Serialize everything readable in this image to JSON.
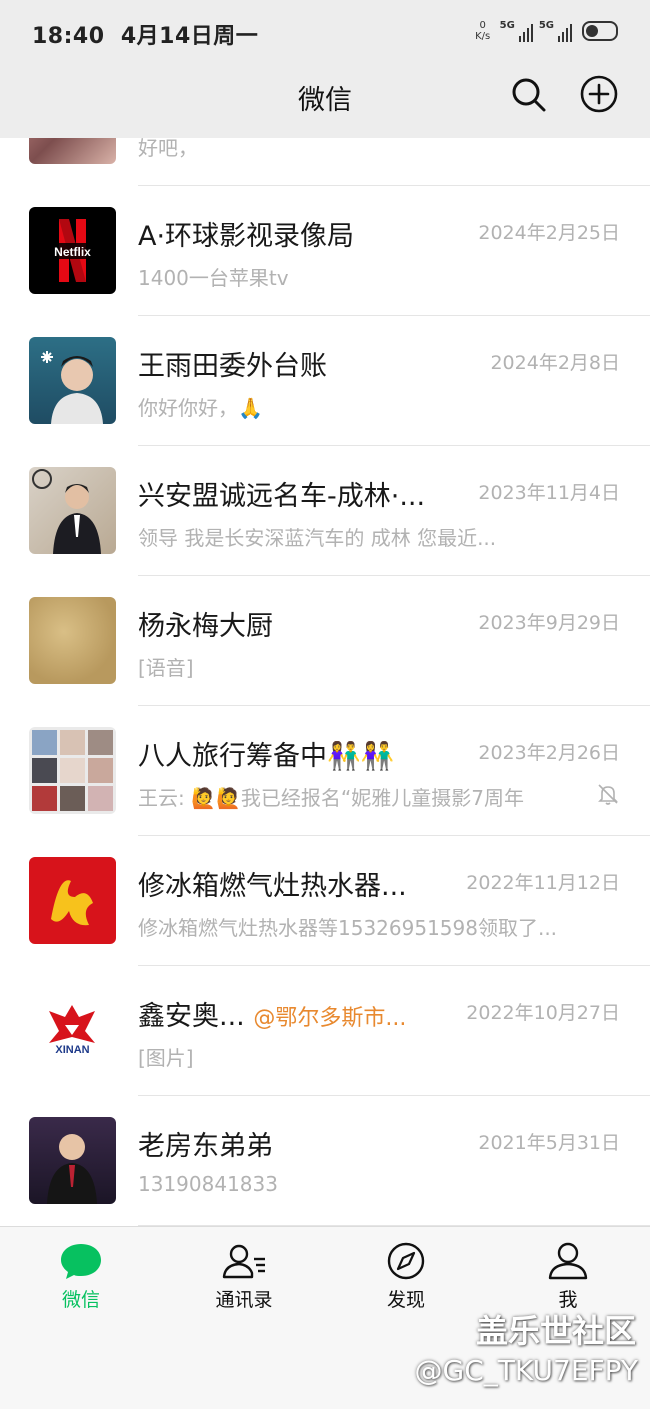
{
  "status_bar": {
    "time": "18:40",
    "date": "4月14日周一",
    "net_speed_value": "0",
    "net_speed_unit": "K/s",
    "sim1": "5G",
    "sim2": "5G"
  },
  "nav": {
    "title": "微信",
    "search_icon": "search-icon",
    "add_icon": "plus-circle-icon"
  },
  "chats": [
    {
      "name": "",
      "preview": "好吧，",
      "date": ""
    },
    {
      "name": "A·环球影视录像局",
      "preview": "1400一台苹果tv",
      "date": "2024年2月25日",
      "avatar_text": "Netflix"
    },
    {
      "name": "王雨田委外台账",
      "preview": "你好你好，🙏",
      "date": "2024年2月8日"
    },
    {
      "name": "兴安盟诚远名车-成林·...",
      "preview": "领导 我是长安深蓝汽车的 成林 您最近...",
      "date": "2023年11月4日"
    },
    {
      "name": "杨永梅大厨",
      "preview": "[语音]",
      "date": "2023年9月29日"
    },
    {
      "name": "八人旅行筹备中👫👫",
      "preview": "王云: 🙋🙋我已经报名“妮雅儿童摄影7周年",
      "date": "2023年2月26日",
      "muted": true
    },
    {
      "name": "修冰箱燃气灶热水器...",
      "preview": "修冰箱燃气灶热水器等15326951598领取了...",
      "date": "2022年11月12日"
    },
    {
      "name": "鑫安奥...",
      "mention": "@鄂尔多斯市...",
      "preview": "[图片]",
      "date": "2022年10月27日",
      "avatar_text": "XINAN"
    },
    {
      "name": "老房东弟弟",
      "preview": "13190841833",
      "date": "2021年5月31日"
    }
  ],
  "tabs": [
    {
      "label": "微信",
      "icon": "chat-bubble-icon",
      "active": true
    },
    {
      "label": "通讯录",
      "icon": "contacts-icon",
      "active": false
    },
    {
      "label": "发现",
      "icon": "compass-icon",
      "active": false
    },
    {
      "label": "我",
      "icon": "person-icon",
      "active": false
    }
  ],
  "watermark": {
    "line1": "盖乐世社区",
    "line2": "@GC_TKU7EFPY"
  },
  "colors": {
    "accent": "#07c160",
    "bar_bg": "#ededed",
    "secondary_text": "#b2b2b2",
    "mention": "#e8892f"
  }
}
